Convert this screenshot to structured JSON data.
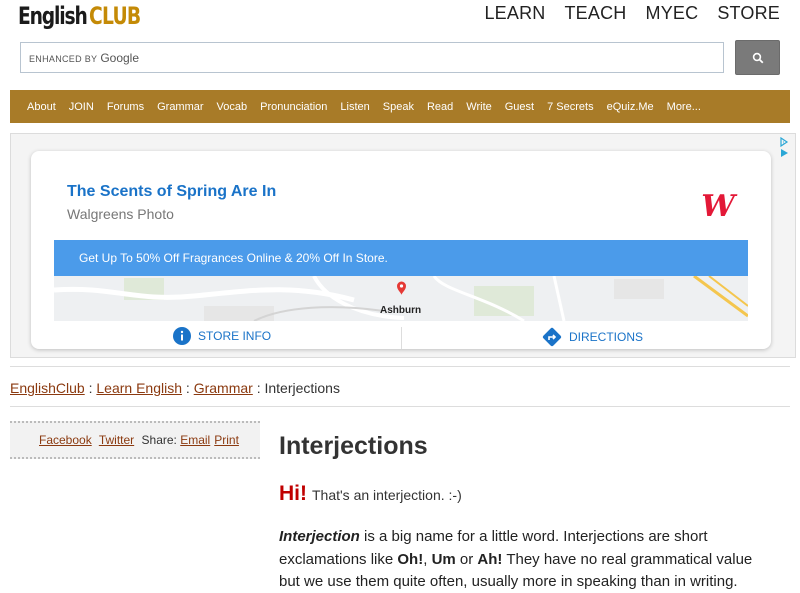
{
  "header": {
    "logo_part1": "English",
    "logo_part2": "CLUB",
    "top_nav": [
      "LEARN",
      "TEACH",
      "MYEC",
      "STORE"
    ]
  },
  "search": {
    "brand_prefix": "ENHANCED BY",
    "brand_name": "Google",
    "value": ""
  },
  "menu": [
    "About",
    "JOIN",
    "Forums",
    "Grammar",
    "Vocab",
    "Pronunciation",
    "Listen",
    "Speak",
    "Read",
    "Write",
    "Guest",
    "7 Secrets",
    "eQuiz.Me",
    "More..."
  ],
  "ad": {
    "title": "The Scents of Spring Are In",
    "subtitle": "Walgreens Photo",
    "logo": "W",
    "banner": "Get Up To 50% Off Fragrances Online & 20% Off In Store.",
    "map_label": "Ashburn",
    "store_info": "STORE INFO",
    "directions": "DIRECTIONS"
  },
  "breadcrumb": {
    "crumb1": "EnglishClub",
    "crumb2": "Learn English",
    "crumb3": "Grammar",
    "current": "Interjections",
    "separator": " : "
  },
  "share": {
    "facebook": "Facebook",
    "twitter": "Twitter",
    "share_label": "Share:",
    "email": "Email",
    "print": "Print"
  },
  "article": {
    "title": "Interjections",
    "hi": "Hi!",
    "hi_text": "That's an interjection. :-)",
    "p1_term": "Interjection",
    "p1_a": " is a big name for a little word. Interjections are short exclamations like ",
    "p1_oh": "Oh!",
    "p1_comma": ", ",
    "p1_um": "Um",
    "p1_or": " or ",
    "p1_ah": "Ah!",
    "p1_b": " They have no real grammatical value but we use them quite often, usually more in speaking than in writing."
  },
  "colors": {
    "menu_bg": "#a87b28",
    "logo_accent": "#c48a06",
    "link": "#8b3a10",
    "hi_red": "#c00000",
    "ad_blue": "#4b9bea",
    "walgreens_red": "#e31837"
  }
}
